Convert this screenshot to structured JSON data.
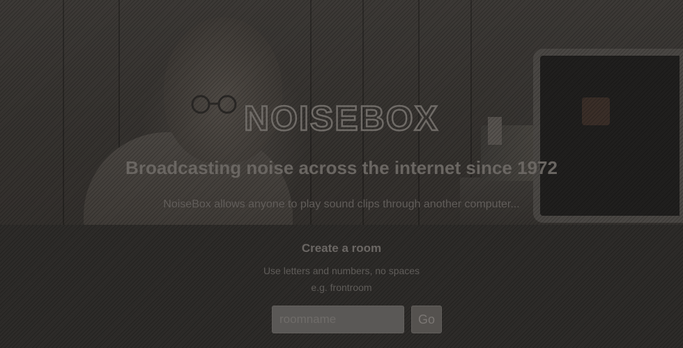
{
  "hero": {
    "logo_text": "NOISEBOX",
    "tagline": "Broadcasting noise across the internet since 1972",
    "intro": "NoiseBox allows anyone to play sound clips through another computer..."
  },
  "create_room": {
    "title": "Create a room",
    "hint": "Use letters and numbers, no spaces",
    "example": "e.g. frontroom",
    "room_input": {
      "placeholder": "roomname",
      "value": ""
    },
    "go_label": "Go"
  },
  "colors": {
    "background": "#2d2b29",
    "text_muted": "#6a6662",
    "logo_stroke": "#6f6b67",
    "input_bg": "#5a5856"
  }
}
